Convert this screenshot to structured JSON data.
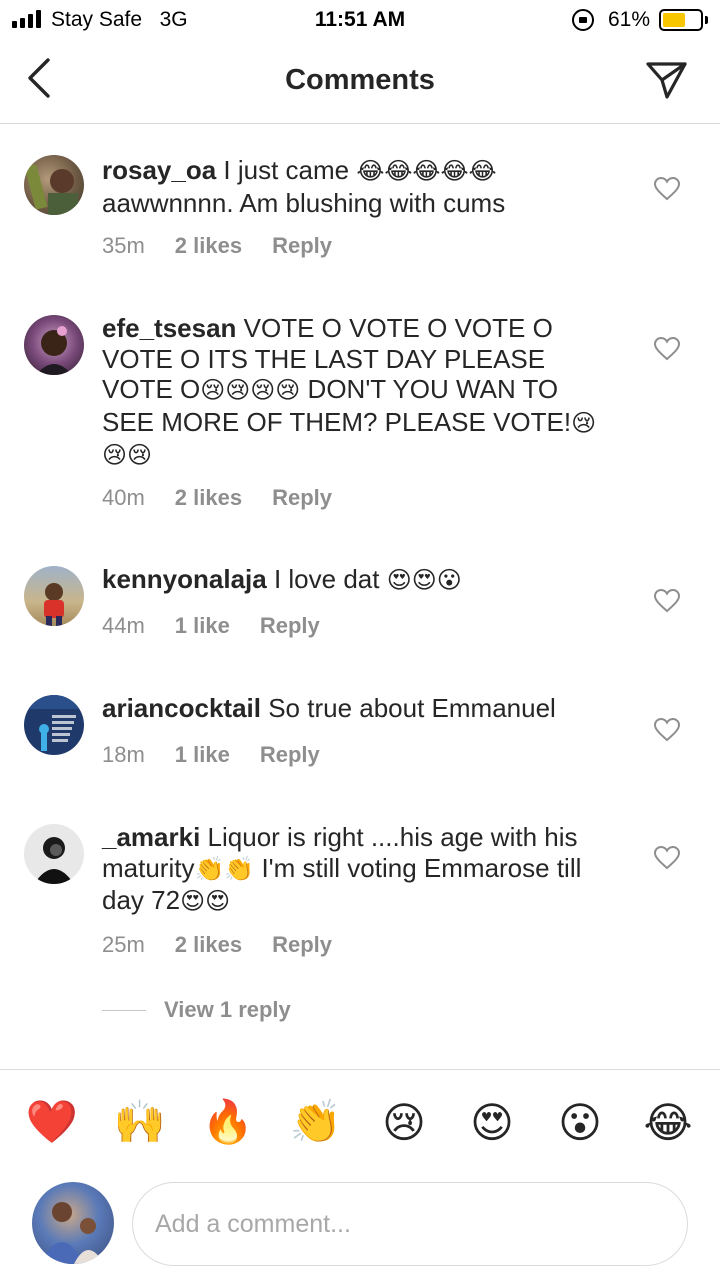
{
  "status_bar": {
    "carrier": "Stay Safe",
    "network": "3G",
    "time": "11:51 AM",
    "battery_percent": "61%",
    "battery_level": 0.61,
    "battery_color": "#f7c600"
  },
  "header": {
    "title": "Comments",
    "back_icon": "chevron-left-icon",
    "send_icon": "paper-plane-icon"
  },
  "comments": [
    {
      "username": "rosay_oa",
      "text_parts": [
        " I just came ",
        "😂😂😂😂😂",
        " aawwnnnn. Am blushing with cums"
      ],
      "time": "35m",
      "likes": "2 likes",
      "reply": "Reply"
    },
    {
      "username": "efe_tsesan",
      "text_parts": [
        " VOTE O VOTE O VOTE O VOTE O ITS THE LAST DAY  PLEASE VOTE O",
        "😢😢😢😢",
        " DON'T YOU WAN TO SEE MORE OF THEM?  PLEASE VOTE!",
        "😢😢😢"
      ],
      "time": "40m",
      "likes": "2 likes",
      "reply": "Reply"
    },
    {
      "username": "kennyonalaja",
      "text_parts": [
        " I love dat ",
        "😍😍😮"
      ],
      "time": "44m",
      "likes": "1 like",
      "reply": "Reply"
    },
    {
      "username": "ariancocktail",
      "text_parts": [
        " So true about Emmanuel"
      ],
      "time": "18m",
      "likes": "1 like",
      "reply": "Reply"
    },
    {
      "username": "_amarki",
      "text_parts": [
        " Liquor is right ....his age with his maturity",
        "👏👏",
        " I'm still voting Emmarose till day 72",
        "😍😍"
      ],
      "time": "25m",
      "likes": "2 likes",
      "reply": "Reply"
    }
  ],
  "view_replies": "View 1 reply",
  "emoji_bar": [
    "❤️",
    "🙌",
    "🔥",
    "👏",
    "😢",
    "😍",
    "😮",
    "😂"
  ],
  "comment_input": {
    "placeholder": "Add a comment..."
  },
  "colors": {
    "text": "#262626",
    "secondary": "#8e8e8e",
    "divider": "#dbdbdb"
  }
}
